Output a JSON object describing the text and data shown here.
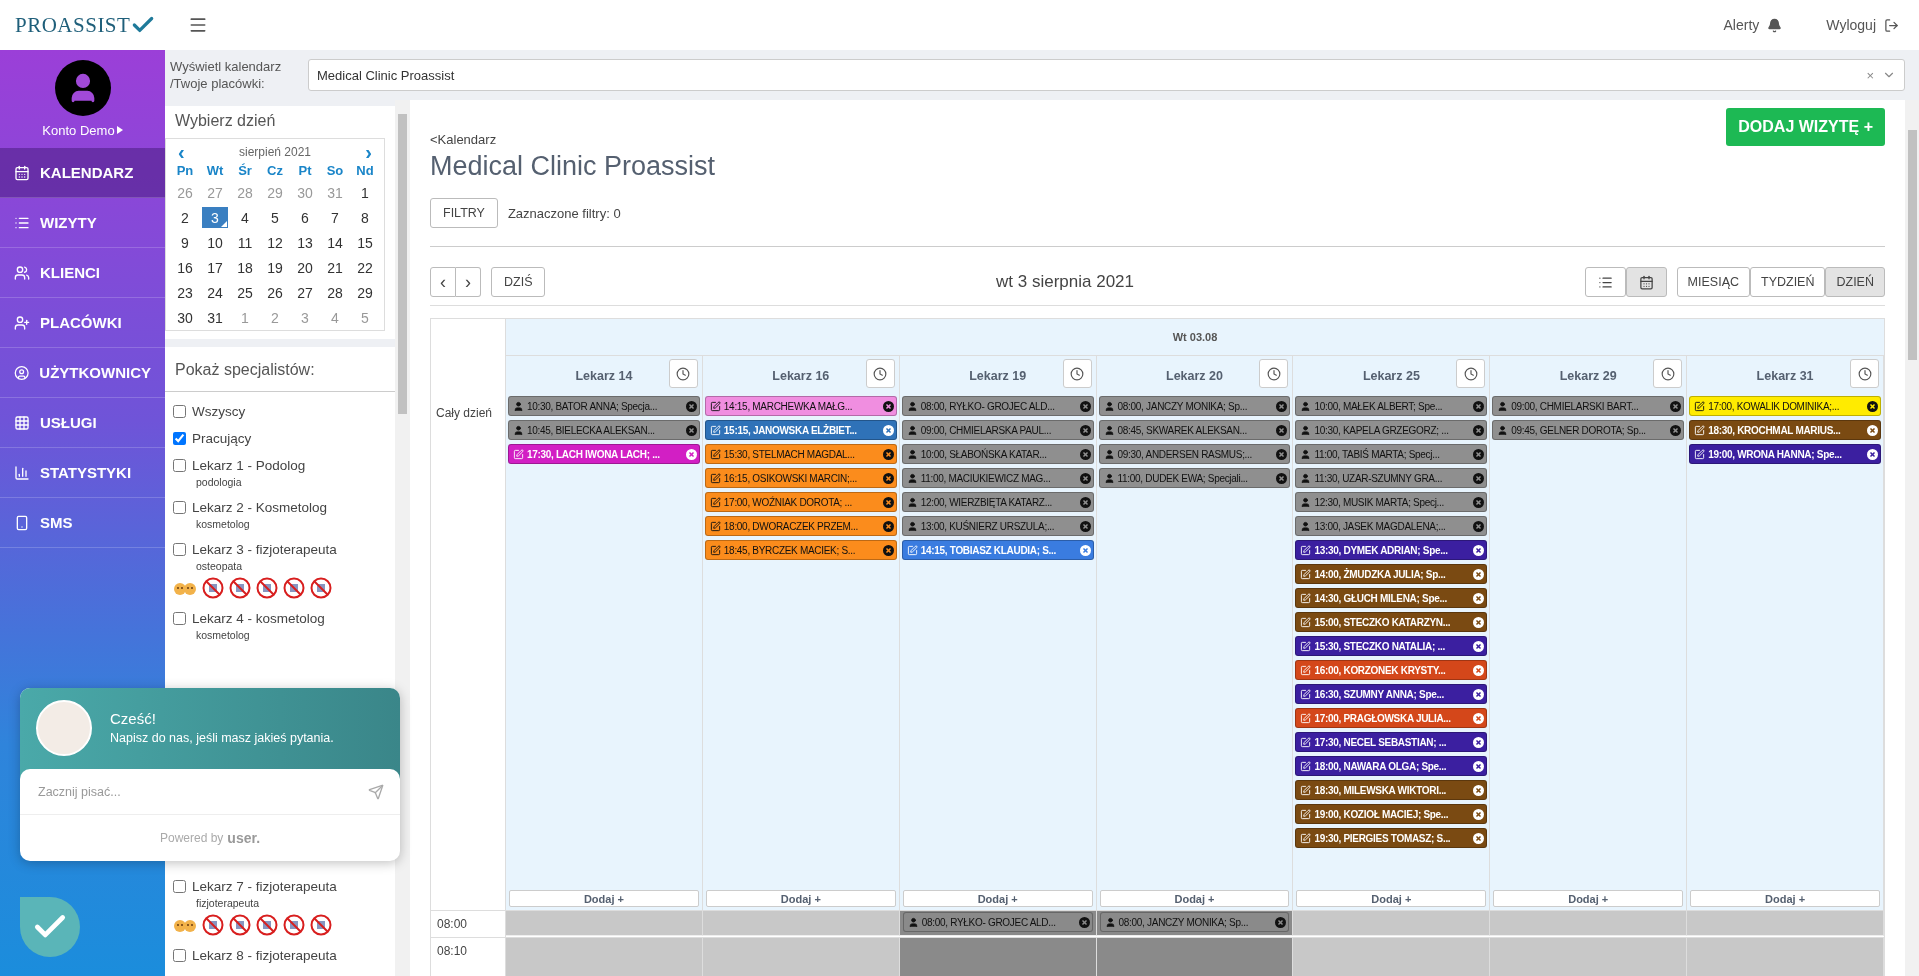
{
  "header": {
    "logo": "PROASSIST",
    "alerts": "Alerty",
    "logout": "Wyloguj"
  },
  "profile": {
    "name": "Konto Demo"
  },
  "nav": [
    {
      "label": "KALENDARZ",
      "kind": "calendar",
      "selected": true
    },
    {
      "label": "WIZYTY",
      "kind": "list",
      "selected": false
    },
    {
      "label": "KLIENCI",
      "kind": "users",
      "selected": false
    },
    {
      "label": "PLACÓWKI",
      "kind": "user-plus",
      "selected": false
    },
    {
      "label": "UŻYTKOWNICY",
      "kind": "user-circle",
      "selected": false
    },
    {
      "label": "USŁUGI",
      "kind": "grid",
      "selected": false
    },
    {
      "label": "STATYSTYKI",
      "kind": "chart",
      "selected": false
    },
    {
      "label": "SMS",
      "kind": "phone",
      "selected": false
    }
  ],
  "clinic_select": {
    "label": "Wyświetl kalendarz /Twoje placówki:",
    "value": "Medical Clinic Proassist",
    "clear": "×"
  },
  "date_picker": {
    "title": "Wybierz dzień",
    "month": "sierpień 2021",
    "prev": "‹",
    "next": "›",
    "weekdays": [
      "Pn",
      "Wt",
      "Śr",
      "Cz",
      "Pt",
      "So",
      "Nd"
    ],
    "days": [
      {
        "label": "26",
        "muted": true,
        "selected": false
      },
      {
        "label": "27",
        "muted": true,
        "selected": false
      },
      {
        "label": "28",
        "muted": true,
        "selected": false
      },
      {
        "label": "29",
        "muted": true,
        "selected": false
      },
      {
        "label": "30",
        "muted": true,
        "selected": false
      },
      {
        "label": "31",
        "muted": true,
        "selected": false
      },
      {
        "label": "1",
        "muted": false,
        "selected": false
      },
      {
        "label": "2",
        "muted": false,
        "selected": false
      },
      {
        "label": "3",
        "muted": false,
        "selected": true
      },
      {
        "label": "4",
        "muted": false,
        "selected": false
      },
      {
        "label": "5",
        "muted": false,
        "selected": false
      },
      {
        "label": "6",
        "muted": false,
        "selected": false
      },
      {
        "label": "7",
        "muted": false,
        "selected": false
      },
      {
        "label": "8",
        "muted": false,
        "selected": false
      },
      {
        "label": "9",
        "muted": false,
        "selected": false
      },
      {
        "label": "10",
        "muted": false,
        "selected": false
      },
      {
        "label": "11",
        "muted": false,
        "selected": false
      },
      {
        "label": "12",
        "muted": false,
        "selected": false
      },
      {
        "label": "13",
        "muted": false,
        "selected": false
      },
      {
        "label": "14",
        "muted": false,
        "selected": false
      },
      {
        "label": "15",
        "muted": false,
        "selected": false
      },
      {
        "label": "16",
        "muted": false,
        "selected": false
      },
      {
        "label": "17",
        "muted": false,
        "selected": false
      },
      {
        "label": "18",
        "muted": false,
        "selected": false
      },
      {
        "label": "19",
        "muted": false,
        "selected": false
      },
      {
        "label": "20",
        "muted": false,
        "selected": false
      },
      {
        "label": "21",
        "muted": false,
        "selected": false
      },
      {
        "label": "22",
        "muted": false,
        "selected": false
      },
      {
        "label": "23",
        "muted": false,
        "selected": false
      },
      {
        "label": "24",
        "muted": false,
        "selected": false
      },
      {
        "label": "25",
        "muted": false,
        "selected": false
      },
      {
        "label": "26",
        "muted": false,
        "selected": false
      },
      {
        "label": "27",
        "muted": false,
        "selected": false
      },
      {
        "label": "28",
        "muted": false,
        "selected": false
      },
      {
        "label": "29",
        "muted": false,
        "selected": false
      },
      {
        "label": "30",
        "muted": false,
        "selected": false
      },
      {
        "label": "31",
        "muted": false,
        "selected": false
      },
      {
        "label": "1",
        "muted": true,
        "selected": false
      },
      {
        "label": "2",
        "muted": true,
        "selected": false
      },
      {
        "label": "3",
        "muted": true,
        "selected": false
      },
      {
        "label": "4",
        "muted": true,
        "selected": false
      },
      {
        "label": "5",
        "muted": true,
        "selected": false
      }
    ]
  },
  "specialists": {
    "title": "Pokaż specjalistów:",
    "items": [
      {
        "name": "Wszyscy",
        "checked": false,
        "kind": "plain"
      },
      {
        "name": "Pracujący",
        "checked": true,
        "kind": "plain"
      },
      {
        "name": "Lekarz 1 - Podolog",
        "subtitle": "podologia",
        "checked": false,
        "kind": "plain"
      },
      {
        "name": "Lekarz 2 - Kosmetolog",
        "subtitle": "kosmetolog",
        "checked": false,
        "kind": "plain"
      },
      {
        "name": "Lekarz 3 - fizjoterapeuta",
        "subtitle": "osteopata",
        "checked": false,
        "kind": "badged"
      },
      {
        "name": "Lekarz 4 - kosmetolog",
        "subtitle": "kosmetolog",
        "checked": false,
        "kind": "plain"
      }
    ],
    "items_below_chat": [
      {
        "name": "Lekarz 7 - fizjoterapeuta",
        "subtitle": "fizjoterapeuta",
        "checked": false,
        "kind": "badged"
      },
      {
        "name": "Lekarz 8 - fizjoterapeuta",
        "checked": false,
        "kind": "plain"
      }
    ]
  },
  "page": {
    "back": "<Kalendarz",
    "title": "Medical Clinic Proassist",
    "add_button": "DODAJ WIZYTĘ +",
    "filters_button": "FILTRY",
    "filters_info": "Zaznaczone filtry: 0"
  },
  "toolbar": {
    "prev": "‹",
    "next": "›",
    "today": "DZIŚ",
    "date": "wt 3 sierpnia 2021",
    "display": [
      {
        "kind": "list",
        "selected": false
      },
      {
        "kind": "calendar",
        "selected": true
      }
    ],
    "views": [
      {
        "label": "MIESIĄC",
        "selected": false
      },
      {
        "label": "TYDZIEŃ",
        "selected": false
      },
      {
        "label": "DZIEŃ",
        "selected": true
      }
    ]
  },
  "day_grid": {
    "day_header": "Wt 03.08",
    "all_day": "Cały dzień",
    "columns": [
      {
        "name": "Lekarz 14",
        "add_label": "Dodaj +",
        "events": [
          {
            "text": "10:30, BATOR ANNA; Specja...",
            "kind": "person",
            "color": "#8f8f8f"
          },
          {
            "text": "10:45, BIELECKA ALEKSAN...",
            "kind": "person",
            "color": "#8f8f8f"
          },
          {
            "text": "17:30, LACH IWONA LACH; ...",
            "kind": "note",
            "color": "#d21fc4"
          }
        ]
      },
      {
        "name": "Lekarz 16",
        "add_label": "Dodaj +",
        "events": [
          {
            "text": "14:15, MARCHEWKA MAŁG...",
            "kind": "note",
            "color": "#f08ee0"
          },
          {
            "text": "15:15, JANOWSKA ELŻBIET...",
            "kind": "note",
            "color": "#2f72b8"
          },
          {
            "text": "15:30, STELMACH MAGDAL...",
            "kind": "note",
            "color": "#fb8c1c"
          },
          {
            "text": "16:15, OSIKOWSKI MARCIN;...",
            "kind": "note",
            "color": "#fb8c1c"
          },
          {
            "text": "17:00, WOŹNIAK DOROTA; ...",
            "kind": "note",
            "color": "#fb8c1c"
          },
          {
            "text": "18:00, DWORACZEK PRZEM...",
            "kind": "note",
            "color": "#fb8c1c"
          },
          {
            "text": "18:45, BYRCZEK MACIEK; S...",
            "kind": "note",
            "color": "#fb8c1c"
          }
        ]
      },
      {
        "name": "Lekarz 19",
        "add_label": "Dodaj +",
        "slot_event": {
          "text": "08:00, RYŁKO- GROJEC ALD...",
          "kind": "person",
          "color": "#8a8a8a"
        },
        "events": [
          {
            "text": "08:00, RYŁKO- GROJEC ALD...",
            "kind": "person",
            "color": "#8f8f8f"
          },
          {
            "text": "09:00, CHMIELARSKA PAUL...",
            "kind": "person",
            "color": "#8f8f8f"
          },
          {
            "text": "10:00, SŁABOŃSKA KATAR...",
            "kind": "person",
            "color": "#8f8f8f"
          },
          {
            "text": "11:00, MACIUKIEWICZ MAG...",
            "kind": "person",
            "color": "#8f8f8f"
          },
          {
            "text": "12:00, WIERZBIĘTA KATARZ...",
            "kind": "person",
            "color": "#8f8f8f"
          },
          {
            "text": "13:00, KUŚNIERZ URSZULA;...",
            "kind": "person",
            "color": "#8f8f8f"
          },
          {
            "text": "14:15, TOBIASZ KLAUDIA; S...",
            "kind": "note",
            "color": "#3a7ce0"
          }
        ]
      },
      {
        "name": "Lekarz 20",
        "add_label": "Dodaj +",
        "slot_event": {
          "text": "08:00, JANCZY MONIKA; Sp...",
          "kind": "person",
          "color": "#8a8a8a"
        },
        "events": [
          {
            "text": "08:00, JANCZY MONIKA; Sp...",
            "kind": "person",
            "color": "#8f8f8f"
          },
          {
            "text": "08:45, SKWAREK ALEKSAN...",
            "kind": "person",
            "color": "#8f8f8f"
          },
          {
            "text": "09:30, ANDERSEN RASMUS;...",
            "kind": "person",
            "color": "#8f8f8f"
          },
          {
            "text": "11:00, DUDEK EWA; Specjali...",
            "kind": "person",
            "color": "#8f8f8f"
          }
        ]
      },
      {
        "name": "Lekarz 25",
        "add_label": "Dodaj +",
        "events": [
          {
            "text": "10:00, MAŁEK ALBERT; Spe...",
            "kind": "person",
            "color": "#8f8f8f"
          },
          {
            "text": "10:30, KAPELA GRZEGORZ; ...",
            "kind": "person",
            "color": "#8f8f8f"
          },
          {
            "text": "11:00, TABIŚ MARTA; Specj...",
            "kind": "person",
            "color": "#8f8f8f"
          },
          {
            "text": "11:30, UZAR-SZUMNY GRA...",
            "kind": "person",
            "color": "#8f8f8f"
          },
          {
            "text": "12:30, MUSIK MARTA; Specj...",
            "kind": "person",
            "color": "#8f8f8f"
          },
          {
            "text": "13:00, JASEK MAGDALENA;...",
            "kind": "person",
            "color": "#8f8f8f"
          },
          {
            "text": "13:30, DYMEK ADRIAN; Spe...",
            "kind": "note",
            "color": "#3b1fa0"
          },
          {
            "text": "14:00, ŻMUDZKA JULIA; Sp...",
            "kind": "note",
            "color": "#7a4a12"
          },
          {
            "text": "14:30, GŁUCH MILENA; Spe...",
            "kind": "note",
            "color": "#7a4a12"
          },
          {
            "text": "15:00, STECZKO KATARZYN...",
            "kind": "note",
            "color": "#7a4a12"
          },
          {
            "text": "15:30, STECZKO NATALIA; ...",
            "kind": "note",
            "color": "#3b1fa0"
          },
          {
            "text": "16:00, KORZONEK KRYSTY...",
            "kind": "note",
            "color": "#d4471a"
          },
          {
            "text": "16:30, SZUMNY ANNA; Spe...",
            "kind": "note",
            "color": "#3b1fa0"
          },
          {
            "text": "17:00, PRAGŁOWSKA JULIA...",
            "kind": "note",
            "color": "#d4471a"
          },
          {
            "text": "17:30, NECEL SEBASTIAN; ...",
            "kind": "note",
            "color": "#3b1fa0"
          },
          {
            "text": "18:00, NAWARA OLGA; Spe...",
            "kind": "note",
            "color": "#3b1fa0"
          },
          {
            "text": "18:30, MILEWSKA WIKTORI...",
            "kind": "note",
            "color": "#7a4a12"
          },
          {
            "text": "19:00, KOZIOŁ MACIEJ; Spe...",
            "kind": "note",
            "color": "#7a4a12"
          },
          {
            "text": "19:30, PIERGIES TOMASZ; S...",
            "kind": "note",
            "color": "#7a4a12"
          }
        ]
      },
      {
        "name": "Lekarz 29",
        "add_label": "Dodaj +",
        "events": [
          {
            "text": "09:00, CHMIELARSKI BART...",
            "kind": "person",
            "color": "#8f8f8f"
          },
          {
            "text": "09:45, GELNER DOROTA; Sp...",
            "kind": "person",
            "color": "#8f8f8f"
          }
        ]
      },
      {
        "name": "Lekarz 31",
        "add_label": "Dodaj +",
        "events": [
          {
            "text": "17:00, KOWALIK DOMINIKA;...",
            "kind": "note",
            "color": "#ffeb00"
          },
          {
            "text": "18:30, KROCHMAL MARIUS...",
            "kind": "note",
            "color": "#7a4a12"
          },
          {
            "text": "19:00, WRONA HANNA; Spe...",
            "kind": "note",
            "color": "#3b1fa0"
          }
        ]
      }
    ],
    "times": [
      "08:00",
      "08:10"
    ]
  },
  "chat": {
    "greeting": "Cześć!",
    "message": "Napisz do nas, jeśli masz jakieś pytania.",
    "placeholder": "Zacznij pisać...",
    "powered": "Powered by",
    "brand": "user."
  }
}
